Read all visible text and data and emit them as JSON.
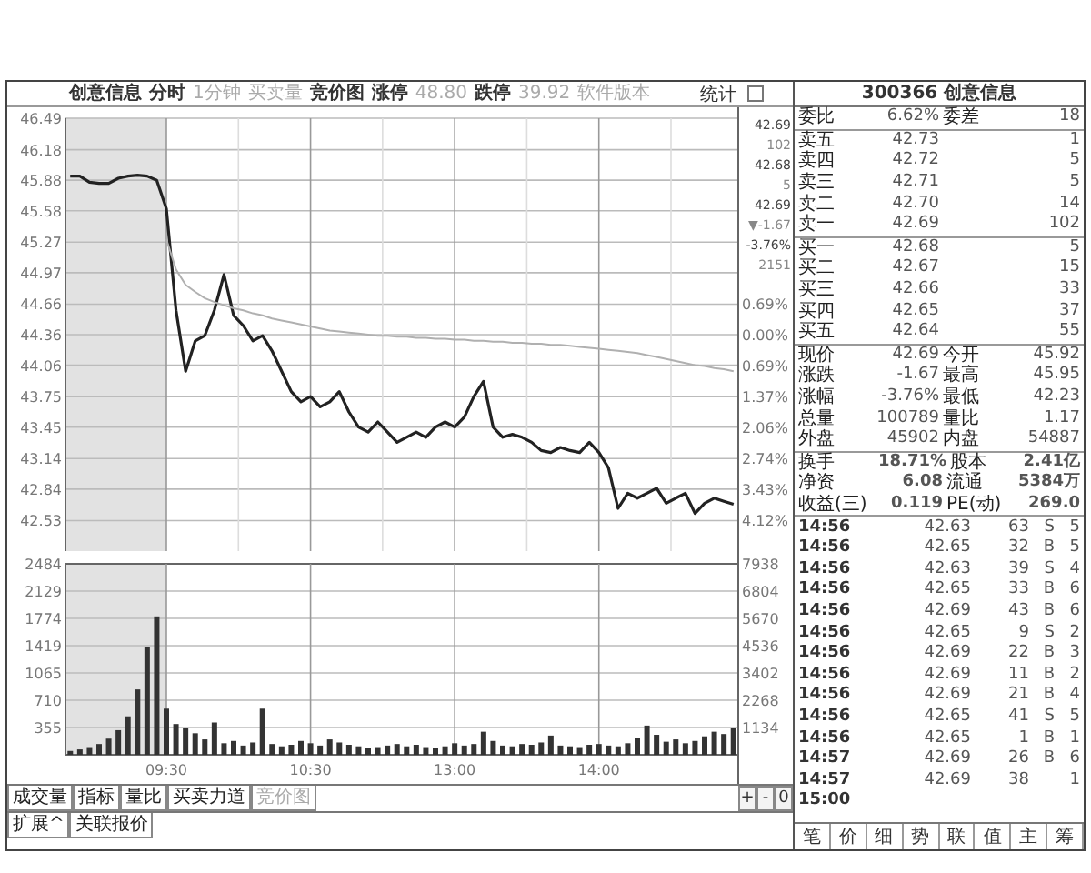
{
  "header": {
    "items": [
      {
        "text": "创意信息",
        "dim": false
      },
      {
        "text": "分时",
        "dim": false
      },
      {
        "text": "1分钟",
        "dim": true
      },
      {
        "text": "买卖量",
        "dim": true
      },
      {
        "text": "竞价图",
        "dim": false
      },
      {
        "text": "涨停",
        "dim": false
      },
      {
        "text": "48.80",
        "dim": true
      },
      {
        "text": "跌停",
        "dim": false
      },
      {
        "text": "39.92",
        "dim": true
      },
      {
        "text": "软件版本",
        "dim": true
      }
    ],
    "stats_button": "统计"
  },
  "price_chart": {
    "chart_data": {
      "type": "line",
      "series": [
        {
          "color": "#222222",
          "values": [
            45.92,
            45.92,
            45.86,
            45.85,
            45.85,
            45.9,
            45.92,
            45.93,
            45.92,
            45.88,
            45.6,
            44.6,
            44.0,
            44.3,
            44.35,
            44.6,
            44.95,
            44.55,
            44.45,
            44.3,
            44.35,
            44.2,
            44.0,
            43.8,
            43.7,
            43.75,
            43.65,
            43.7,
            43.8,
            43.6,
            43.45,
            43.4,
            43.5,
            43.4,
            43.3,
            43.35,
            43.4,
            43.35,
            43.45,
            43.5,
            43.45,
            43.55,
            43.75,
            43.9,
            43.45,
            43.35,
            43.38,
            43.35,
            43.3,
            43.22,
            43.2,
            43.25,
            43.22,
            43.2,
            43.3,
            43.2,
            43.05,
            42.65,
            42.8,
            42.75,
            42.8,
            42.85,
            42.7,
            42.75,
            42.8,
            42.6,
            42.7,
            42.75,
            42.72,
            42.69
          ]
        },
        {
          "color": "#b0b0b0",
          "values": [
            null,
            null,
            null,
            null,
            null,
            null,
            null,
            null,
            null,
            null,
            45.3,
            45.0,
            44.85,
            44.78,
            44.72,
            44.68,
            44.65,
            44.62,
            44.6,
            44.57,
            44.55,
            44.52,
            44.5,
            44.48,
            44.46,
            44.44,
            44.42,
            44.4,
            44.39,
            44.38,
            44.37,
            44.36,
            44.35,
            44.35,
            44.34,
            44.34,
            44.33,
            44.33,
            44.32,
            44.32,
            44.31,
            44.31,
            44.3,
            44.3,
            44.29,
            44.29,
            44.28,
            44.28,
            44.27,
            44.27,
            44.26,
            44.26,
            44.25,
            44.24,
            44.23,
            44.22,
            44.21,
            44.2,
            44.19,
            44.18,
            44.16,
            44.14,
            44.12,
            44.1,
            44.08,
            44.06,
            44.05,
            44.03,
            44.02,
            44.0
          ]
        }
      ],
      "grid": true,
      "ylim": [
        42.23,
        46.49
      ],
      "yticks": [
        46.49,
        46.18,
        45.88,
        45.58,
        45.27,
        44.97,
        44.66,
        44.36,
        44.06,
        43.75,
        43.45,
        43.14,
        42.84,
        42.53
      ]
    },
    "right_ticks": [
      "0.69%",
      "0.00%",
      "0.69%",
      "1.37%",
      "2.06%",
      "2.74%",
      "3.43%",
      "4.12%"
    ],
    "quote": [
      "42.69",
      "102",
      "42.68",
      "5",
      "42.69",
      "▼-1.67",
      "-3.76%",
      "2151"
    ]
  },
  "volume_chart": {
    "chart_data": {
      "type": "bar",
      "categories": [
        null,
        null,
        null,
        null,
        null,
        null,
        null,
        null,
        null,
        null,
        "09:30",
        null,
        null,
        null,
        null,
        null,
        null,
        null,
        null,
        null,
        null,
        null,
        null,
        null,
        null,
        "10:30",
        null,
        null,
        null,
        null,
        null,
        null,
        null,
        null,
        null,
        null,
        null,
        null,
        null,
        null,
        "13:00",
        null,
        null,
        null,
        null,
        null,
        null,
        null,
        null,
        null,
        null,
        null,
        null,
        null,
        null,
        "14:00",
        null,
        null,
        null,
        null,
        null,
        null,
        null,
        null,
        null,
        null,
        null,
        null,
        null,
        null
      ],
      "values": [
        50,
        70,
        100,
        140,
        210,
        320,
        500,
        850,
        1400,
        1800,
        600,
        400,
        350,
        280,
        200,
        420,
        150,
        180,
        120,
        160,
        600,
        140,
        110,
        130,
        180,
        150,
        120,
        200,
        160,
        130,
        110,
        90,
        100,
        120,
        140,
        110,
        130,
        100,
        90,
        110,
        150,
        120,
        140,
        300,
        180,
        120,
        110,
        140,
        130,
        160,
        250,
        120,
        110,
        100,
        130,
        140,
        120,
        110,
        150,
        220,
        380,
        260,
        170,
        200,
        150,
        180,
        240,
        300,
        270,
        350
      ],
      "grid": true,
      "ylim": [
        0,
        2484
      ],
      "yticks": [
        2484,
        2129,
        1774,
        1419,
        1065,
        710,
        355
      ]
    },
    "right_ticks": [
      "7938",
      "6804",
      "5670",
      "4536",
      "3402",
      "2268",
      "1134"
    ]
  },
  "indicator_tabs": [
    {
      "label": "成交量",
      "disabled": false
    },
    {
      "label": "指标",
      "disabled": false
    },
    {
      "label": "量比",
      "disabled": false
    },
    {
      "label": "买卖力道",
      "disabled": false
    },
    {
      "label": "竞价图",
      "disabled": true
    }
  ],
  "scroll_buttons": [
    "+",
    "-",
    "0"
  ],
  "extra_tabs": [
    "扩展^",
    "关联报价"
  ],
  "quote_panel": {
    "title": "300366 创意信息",
    "ratio": {
      "label": "委比",
      "value": "6.62%",
      "label2": "委差",
      "value2": "18"
    },
    "asks": [
      {
        "label": "卖五",
        "price": "42.73",
        "volume": "1"
      },
      {
        "label": "卖四",
        "price": "42.72",
        "volume": "5"
      },
      {
        "label": "卖三",
        "price": "42.71",
        "volume": "5"
      },
      {
        "label": "卖二",
        "price": "42.70",
        "volume": "14"
      },
      {
        "label": "卖一",
        "price": "42.69",
        "volume": "102"
      }
    ],
    "bids": [
      {
        "label": "买一",
        "price": "42.68",
        "volume": "5"
      },
      {
        "label": "买二",
        "price": "42.67",
        "volume": "15"
      },
      {
        "label": "买三",
        "price": "42.66",
        "volume": "33"
      },
      {
        "label": "买四",
        "price": "42.65",
        "volume": "37"
      },
      {
        "label": "买五",
        "price": "42.64",
        "volume": "55"
      }
    ],
    "stats": [
      {
        "label": "现价",
        "value": "42.69",
        "label2": "今开",
        "value2": "45.92"
      },
      {
        "label": "涨跌",
        "value": "-1.67",
        "label2": "最高",
        "value2": "45.95"
      },
      {
        "label": "涨幅",
        "value": "-3.76%",
        "label2": "最低",
        "value2": "42.23"
      },
      {
        "label": "总量",
        "value": "100789",
        "label2": "量比",
        "value2": "1.17"
      },
      {
        "label": "外盘",
        "value": "45902",
        "label2": "内盘",
        "value2": "54887"
      }
    ],
    "stats2": [
      {
        "label": "换手",
        "value": "18.71%",
        "label2": "股本",
        "value2": "2.41亿"
      },
      {
        "label": "净资",
        "value": "6.08",
        "label2": "流通",
        "value2": "5384万"
      },
      {
        "label": "收益(三)",
        "value": "0.119",
        "label2": "PE(动)",
        "value2": "269.0"
      }
    ],
    "ticks": [
      {
        "time": "14:56",
        "price": "42.63",
        "volume": "63",
        "side": "S",
        "count": "5"
      },
      {
        "time": "14:56",
        "price": "42.65",
        "volume": "32",
        "side": "B",
        "count": "5"
      },
      {
        "time": "14:56",
        "price": "42.63",
        "volume": "39",
        "side": "S",
        "count": "4"
      },
      {
        "time": "14:56",
        "price": "42.65",
        "volume": "33",
        "side": "B",
        "count": "6"
      },
      {
        "time": "14:56",
        "price": "42.69",
        "volume": "43",
        "side": "B",
        "count": "6"
      },
      {
        "time": "14:56",
        "price": "42.65",
        "volume": "9",
        "side": "S",
        "count": "2"
      },
      {
        "time": "14:56",
        "price": "42.69",
        "volume": "22",
        "side": "B",
        "count": "3"
      },
      {
        "time": "14:56",
        "price": "42.69",
        "volume": "11",
        "side": "B",
        "count": "2"
      },
      {
        "time": "14:56",
        "price": "42.69",
        "volume": "21",
        "side": "B",
        "count": "4"
      },
      {
        "time": "14:56",
        "price": "42.65",
        "volume": "41",
        "side": "S",
        "count": "5"
      },
      {
        "time": "14:56",
        "price": "42.65",
        "volume": "1",
        "side": "B",
        "count": "1"
      },
      {
        "time": "14:57",
        "price": "42.69",
        "volume": "26",
        "side": "B",
        "count": "6"
      },
      {
        "time": "14:57",
        "price": "42.69",
        "volume": "38",
        "count": "1"
      },
      {
        "time": "15:00"
      }
    ],
    "bottom_tabs": [
      "笔",
      "价",
      "细",
      "势",
      "联",
      "值",
      "主",
      "筹"
    ]
  }
}
